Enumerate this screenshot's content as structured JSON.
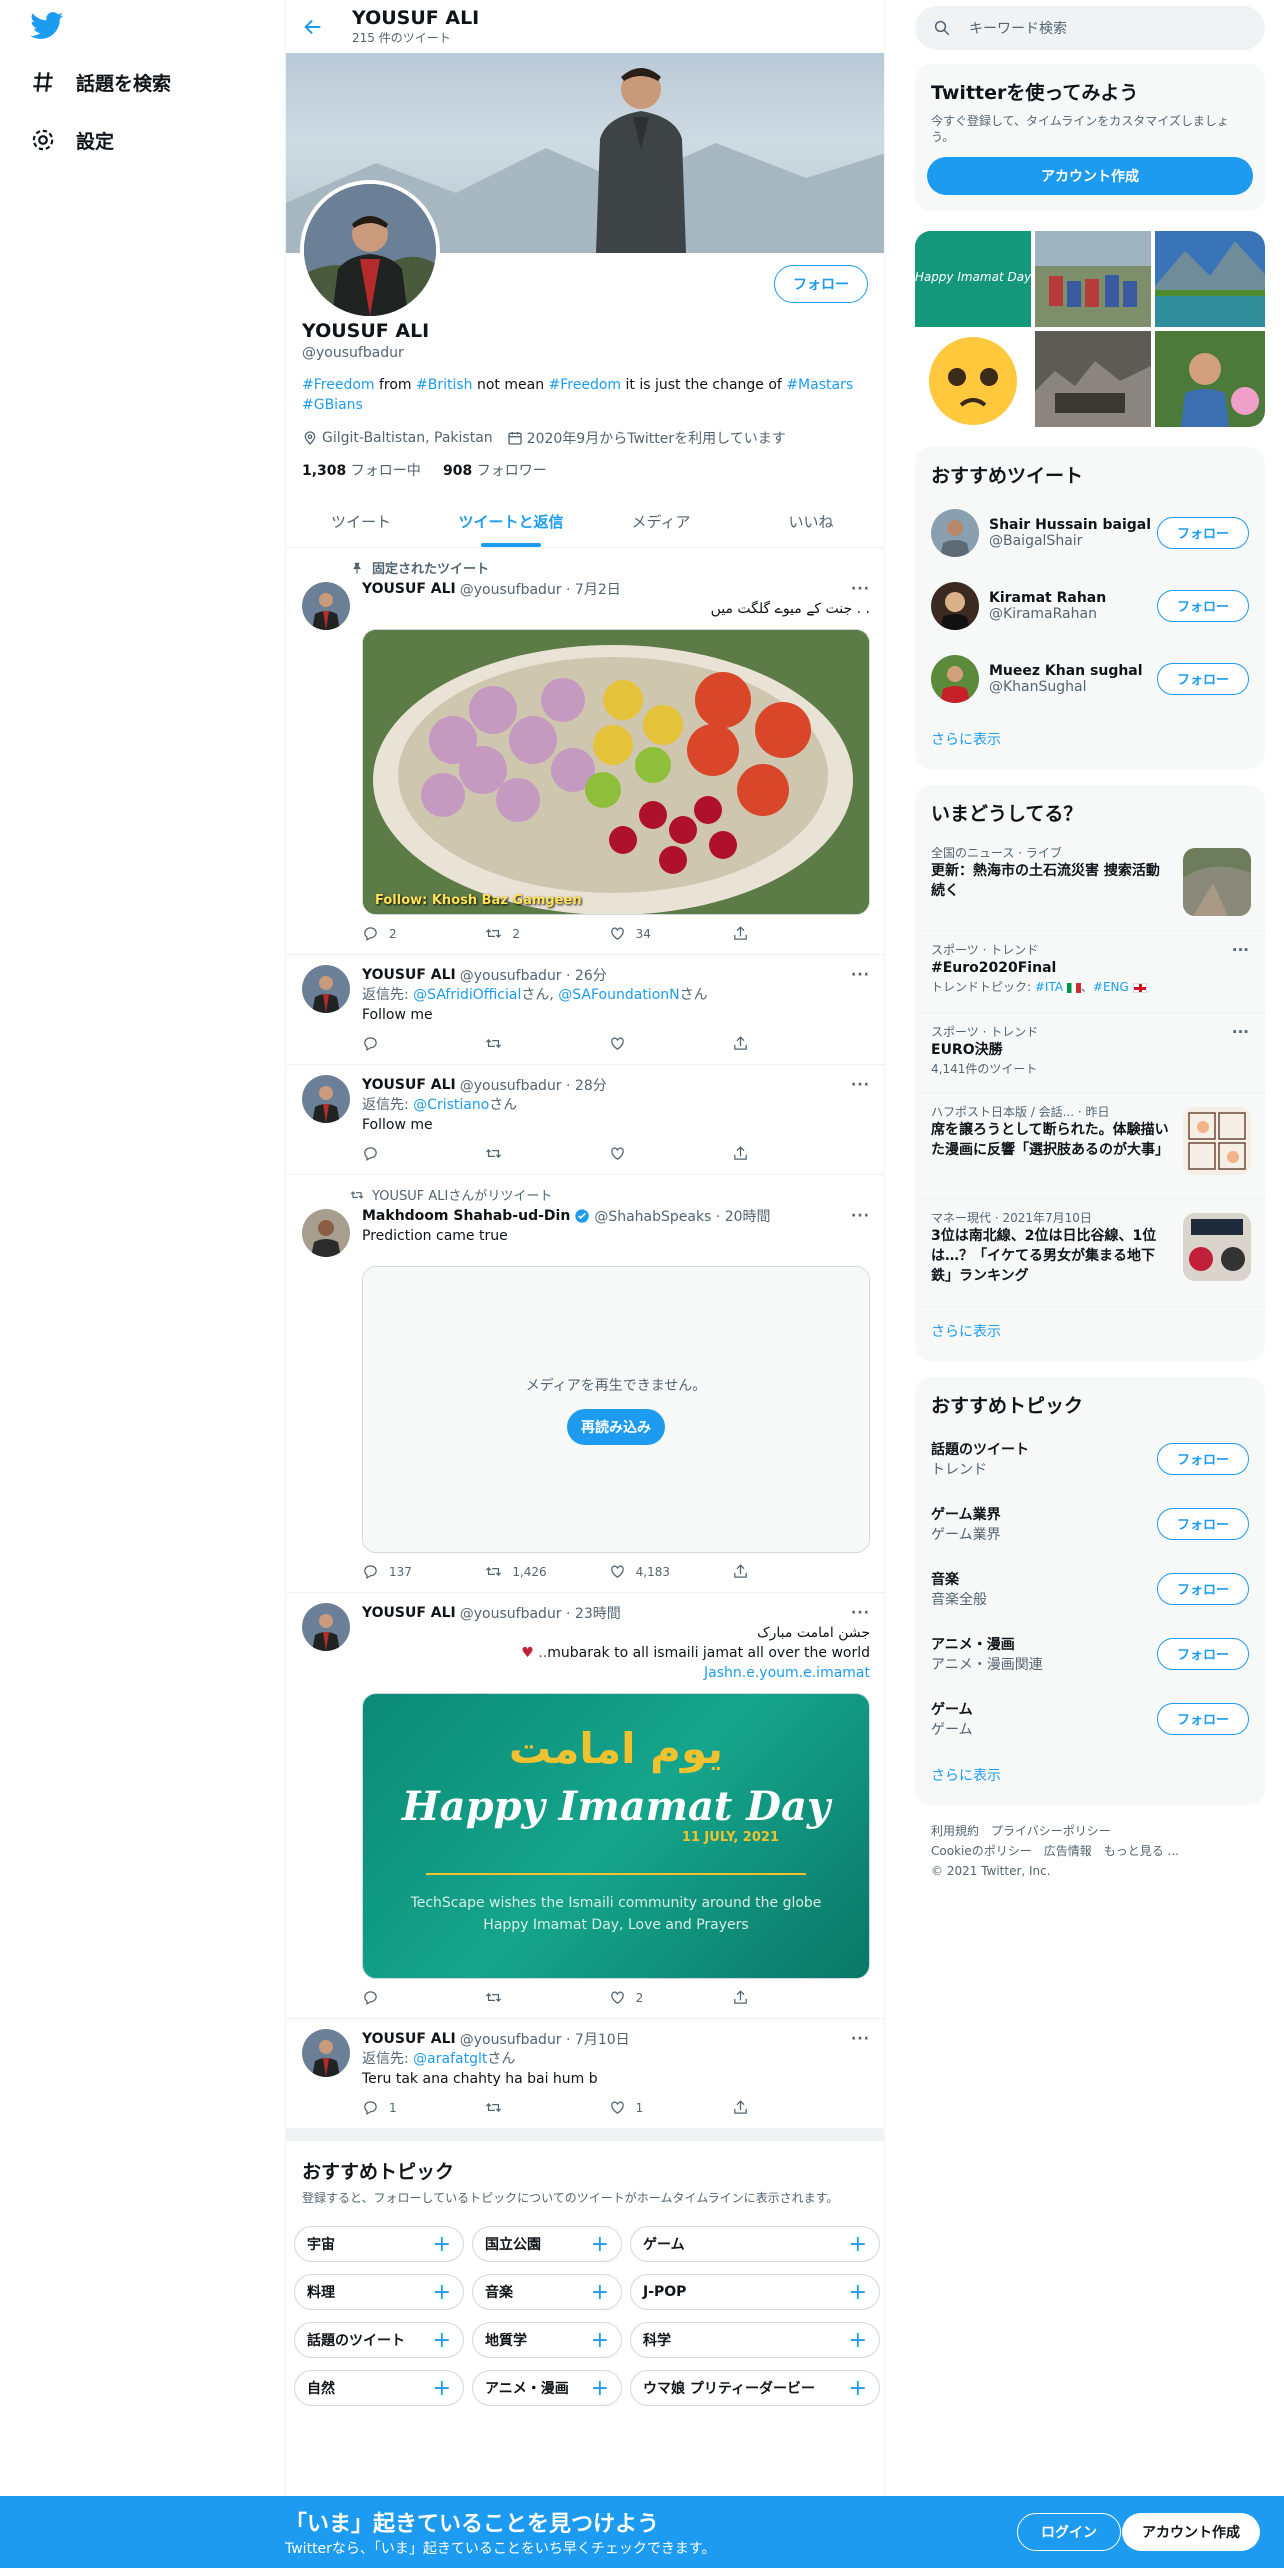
{
  "colors": {
    "accent": "#1d9bf0",
    "text": "#0f1419",
    "muted": "#536471",
    "bg_gray": "#f7f9f9"
  },
  "leftnav": {
    "items": [
      {
        "icon": "hashtag-icon",
        "label": "話題を検索"
      },
      {
        "icon": "gear-icon",
        "label": "設定"
      }
    ]
  },
  "header": {
    "name": "YOUSUF ALI",
    "tweet_count": "215 件のツイート"
  },
  "profile": {
    "name": "YOUSUF ALI",
    "handle": "@yousufbadur",
    "follow_label": "フォロー",
    "bio": [
      {
        "t": "#Freedom",
        "h": true
      },
      {
        "t": " from ",
        "h": false
      },
      {
        "t": "#British",
        "h": true
      },
      {
        "t": " not mean ",
        "h": false
      },
      {
        "t": "#Freedom",
        "h": true
      },
      {
        "t": " it is just the change of ",
        "h": false
      },
      {
        "t": "#Mastars",
        "h": true
      },
      {
        "t": " ",
        "h": false
      },
      {
        "t": "#GBians",
        "h": true
      }
    ],
    "location": "Gilgit-Baltistan, Pakistan",
    "joined": "2020年9月からTwitterを利用しています",
    "following_count": "1,308",
    "following_label": "フォロー中",
    "followers_count": "908",
    "followers_label": "フォロワー"
  },
  "tabs": [
    "ツイート",
    "ツイートと返信",
    "メディア",
    "いいね"
  ],
  "active_tab": 1,
  "tweets": {
    "pinned": {
      "social": "固定されたツイート",
      "name": "YOUSUF ALI",
      "handle": "@yousufbadur · 7月2日",
      "text": "جنت کے میوے گلگت میں . .",
      "image_caption": "Follow: Khosh Baz Gamgeen",
      "replies": "2",
      "retweets": "2",
      "likes": "34"
    },
    "t2": {
      "name": "YOUSUF ALI",
      "handle": "@yousufbadur · 26分",
      "reply_prefix": "返信先: ",
      "reply_to1": "@SAfridiOfficial",
      "san": "さん",
      "comma": ", ",
      "reply_to2": "@SAFoundationN",
      "text": "Follow me"
    },
    "t3": {
      "name": "YOUSUF ALI",
      "handle": "@yousufbadur · 28分",
      "reply_prefix": "返信先: ",
      "reply_to1": "@Cristiano",
      "san": "さん",
      "text": "Follow me"
    },
    "t4": {
      "social": "YOUSUF ALIさんがリツイート",
      "name": "Makhdoom Shahab-ud-Din",
      "handle": "@ShahabSpeaks · 20時間",
      "text": "Prediction came true",
      "video_msg": "メディアを再生できません。",
      "reload": "再読み込み",
      "replies": "137",
      "retweets": "1,426",
      "likes": "4,183"
    },
    "t5": {
      "name": "YOUSUF ALI",
      "handle": "@yousufbadur · 23時間",
      "text_ur": "جشن امامت مبارک",
      "text2": "mubarak to all ismaili jamat all over the world",
      "heart": "♥ ..",
      "link": "Jashn.e.youm.e.imamat",
      "img_urdu": "یوم امامت",
      "img_title": "Happy Imamat Day",
      "img_date": "11 JULY, 2021",
      "img_line1": "TechScape wishes the Ismaili community around the globe",
      "img_line2": "Happy Imamat Day, Love and Prayers",
      "likes": "2"
    },
    "t6": {
      "name": "YOUSUF ALI",
      "handle": "@yousufbadur · 7月10日",
      "reply_prefix": "返信先: ",
      "reply_to1": "@arafatglt",
      "san": "さん",
      "text": "Teru tak ana chahty ha bai hum b",
      "replies": "1",
      "likes": "1"
    }
  },
  "topics": {
    "title": "おすすめトピック",
    "sub": "登録すると、フォローしているトピックについてのツイートがホームタイムラインに表示されます。",
    "chips": [
      "宇宙",
      "国立公園",
      "ゲーム",
      "料理",
      "音楽",
      "J-POP",
      "話題のツイート",
      "地質学",
      "科学",
      "自然",
      "アニメ・漫画",
      "ウマ娘 プリティーダービー"
    ]
  },
  "right": {
    "search_placeholder": "キーワード検索",
    "signup": {
      "title": "Twitterを使ってみよう",
      "sub": "今すぐ登録して、タイムラインをカスタマイズしましょう。",
      "btn": "アカウント作成"
    },
    "who": {
      "title": "おすすめツイート",
      "items": [
        {
          "name": "Shair Hussain baigal",
          "handle": "@BaigalShair"
        },
        {
          "name": "Kiramat Rahan",
          "handle": "@KiramaRahan"
        },
        {
          "name": "Mueez Khan sughal",
          "handle": "@KhanSughal"
        }
      ],
      "follow": "フォロー",
      "more": "さらに表示"
    },
    "trends": {
      "title": "いまどうしてる？",
      "items": [
        {
          "ctx": "全国のニュース · ライブ",
          "ttl": "更新：熱海市の土石流災害 捜索活動続く",
          "ex": ""
        },
        {
          "ctx": "スポーツ · トレンド",
          "ttl": "#Euro2020Final",
          "ex": "トレンドトピック: ",
          "ex1": "#ITA",
          "ex2": "#ENG"
        },
        {
          "ctx": "スポーツ · トレンド",
          "ttl": "EURO決勝",
          "ex": "4,141件のツイート"
        },
        {
          "ctx": "ハフポスト日本版 / 会話... · 昨日",
          "ttl": "席を譲ろうとして断られた。体験描いた漫画に反響「選択肢あるのが大事」",
          "ex": ""
        },
        {
          "ctx": "マネー現代 · 2021年7月10日",
          "ttl": "3位は南北線、2位は日比谷線、1位は…？「イケてる男女が集まる地下鉄」ランキング",
          "ex": ""
        }
      ],
      "more": "さらに表示"
    },
    "topics": {
      "title": "おすすめトピック",
      "items": [
        {
          "name": "話題のツイート",
          "sub": "トレンド"
        },
        {
          "name": "ゲーム業界",
          "sub": "ゲーム業界"
        },
        {
          "name": "音楽",
          "sub": "音楽全般"
        },
        {
          "name": "アニメ・漫画",
          "sub": "アニメ・漫画関連"
        },
        {
          "name": "ゲーム",
          "sub": "ゲーム"
        }
      ],
      "follow": "フォロー",
      "more": "さらに表示"
    },
    "footer": {
      "l1": "利用規約　プライバシーポリシー",
      "l2": "Cookieのポリシー　広告情報　もっと見る ...",
      "l3": "© 2021 Twitter, Inc."
    }
  },
  "bottombar": {
    "headline": "「いま」起きていることを見つけよう",
    "sub": "Twitterなら、「いま」起きていることをいち早くチェックできます。",
    "login": "ログイン",
    "signup": "アカウント作成"
  }
}
